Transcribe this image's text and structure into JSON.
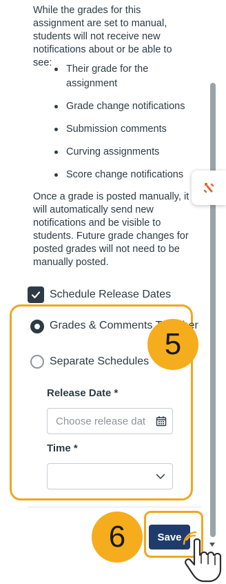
{
  "intro_text": "While the grades for this assignment are set to manual, students will not receive new notifications about or be able to see:",
  "bullets": [
    "Their grade for the assignment",
    "Grade change notifications",
    "Submission comments",
    "Curving assignments",
    "Score change notifications"
  ],
  "outro_text": "Once a grade is posted manually, it will automatically send new notifications and be visible to students. Future grade changes for posted grades will not need to be manually posted.",
  "schedule": {
    "label": "Schedule Release Dates",
    "checked": true
  },
  "radios": [
    {
      "label": "Grades & Comments Together",
      "selected": true
    },
    {
      "label": "Separate Schedules",
      "selected": false
    }
  ],
  "release_date": {
    "label": "Release Date *",
    "placeholder": "Choose release date",
    "value": ""
  },
  "time": {
    "label": "Time *",
    "value": ""
  },
  "save_label": "Save",
  "callouts": {
    "step_5": "5",
    "step_6": "6"
  },
  "colors": {
    "highlight": "#f0a71e",
    "badge": "#f5ad1e",
    "save_button": "#1f3b6b",
    "widget_accent": "#e8632b"
  },
  "icons": {
    "checkbox": "check-icon",
    "date": "calendar-icon",
    "select": "chevron-down-icon",
    "widget": "assistant-icon",
    "cursor": "hand-pointer-icon"
  }
}
